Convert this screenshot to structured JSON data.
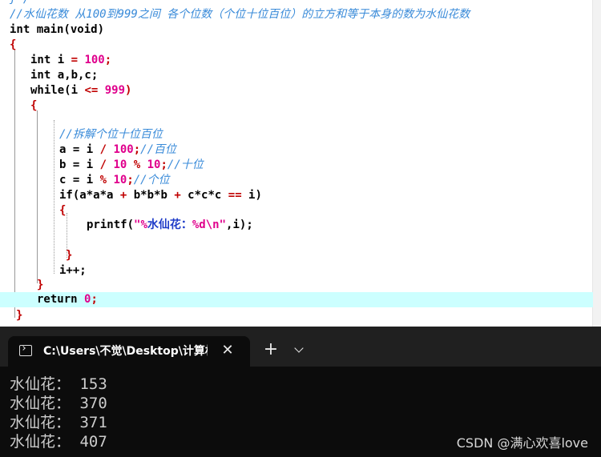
{
  "editor": {
    "top_partial": "}*/",
    "comment_header": "//水仙花数 从100到999之间 各个位数（个位十位百位）的立方和等于本身的数为水仙花数",
    "main_sig": "int main(void)",
    "open_brace": "{",
    "decl_i_kw": "int i ",
    "decl_i_eq": "=",
    "decl_i_val": " 100",
    "semi": ";",
    "decl_abc": "int a,b,c;",
    "while_kw": "while(i ",
    "while_op": "<=",
    "while_val": " 999",
    "while_close": ")",
    "comment_split": "//拆解个位十位百位",
    "a_line_lhs": "a = i ",
    "a_line_div": "/",
    "a_line_num": " 100",
    "a_line_comment": "//百位",
    "b_line_lhs": "b = i ",
    "b_line_div": "/",
    "b_line_num1": " 10 ",
    "b_line_mod": "%",
    "b_line_num2": " 10",
    "b_line_comment": "//十位",
    "c_line_lhs": "c = i ",
    "c_line_mod": "%",
    "c_line_num": " 10",
    "c_line_comment": "//个位",
    "if_part1": "if(a*a*a ",
    "if_plus1": "+",
    "if_part2": " b*b*b ",
    "if_plus2": "+",
    "if_part3": " c*c*c ",
    "if_eq": "==",
    "if_part4": " i)",
    "printf_fn": "printf(",
    "printf_q1": "\"%",
    "printf_cn": "水仙花：",
    "printf_q2": "%d\\n\"",
    "printf_rest": ",i);",
    "close_brace": "}",
    "incr": "i++;",
    "return_kw": "return ",
    "return_val": "0",
    "return_semi": ";"
  },
  "terminal": {
    "tab_title": "C:\\Users\\不觉\\Desktop\\计算机",
    "close_symbol": "✕",
    "new_tab_symbol": "+",
    "output": [
      "水仙花： 153",
      "水仙花： 370",
      "水仙花： 371",
      "水仙花： 407"
    ]
  },
  "watermark": "CSDN @满心欢喜love"
}
